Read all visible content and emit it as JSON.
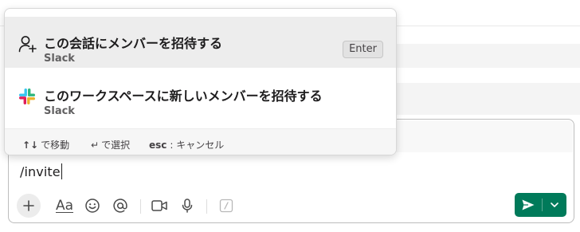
{
  "popup": {
    "items": [
      {
        "title": "この会話にメンバーを招待する",
        "subtitle": "Slack",
        "icon": "add-user-icon",
        "shortcut": "Enter",
        "selected": true
      },
      {
        "title": "このワークスペースに新しいメンバーを招待する",
        "subtitle": "Slack",
        "icon": "slack-logo-icon",
        "selected": false
      }
    ],
    "footer": {
      "move": "で移動",
      "select": "で選択",
      "esc_key": "esc",
      "cancel": ": キャンセル"
    }
  },
  "composer": {
    "input_value": "/invite"
  },
  "toolbar": {
    "format_label": "Aa"
  },
  "colors": {
    "send_button": "#007a5a",
    "selected_row": "#ededed"
  }
}
